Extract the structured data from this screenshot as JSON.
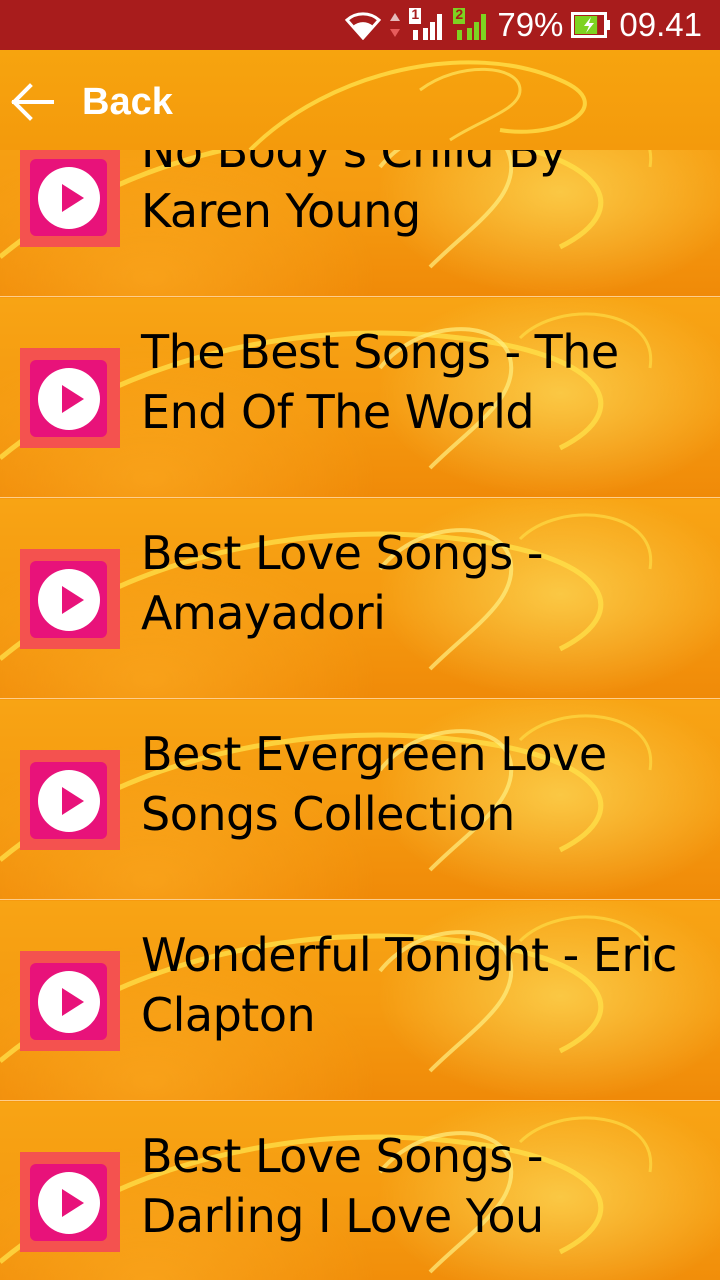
{
  "status_bar": {
    "sim1_badge": "1",
    "sim2_badge": "2",
    "battery_percent": "79%",
    "battery_level": 0.79,
    "clock": "09.41",
    "icons": [
      "wifi-icon",
      "data-arrows-icon",
      "sim1-signal-icon",
      "sim2-signal-icon",
      "battery-charging-icon"
    ],
    "colors": {
      "background": "#a81c1c",
      "sim2_signal": "#7ed321",
      "battery_fill": "#7ed321"
    }
  },
  "header": {
    "back_label": "Back",
    "back_icon": "arrow-left-icon"
  },
  "songs": [
    {
      "title": "No Body's Child By Karen Young"
    },
    {
      "title": "The Best Songs - The End Of The World"
    },
    {
      "title": "Best Love Songs - Amayadori"
    },
    {
      "title": "Best Evergreen Love Songs Collection"
    },
    {
      "title": "Wonderful Tonight - Eric Clapton"
    },
    {
      "title": "Best Love Songs - Darling I Love You"
    }
  ],
  "theme": {
    "accent": "#e8127a",
    "thumb_border": "#f4524f",
    "list_background": "#f79a0f",
    "text_color": "#000000"
  }
}
